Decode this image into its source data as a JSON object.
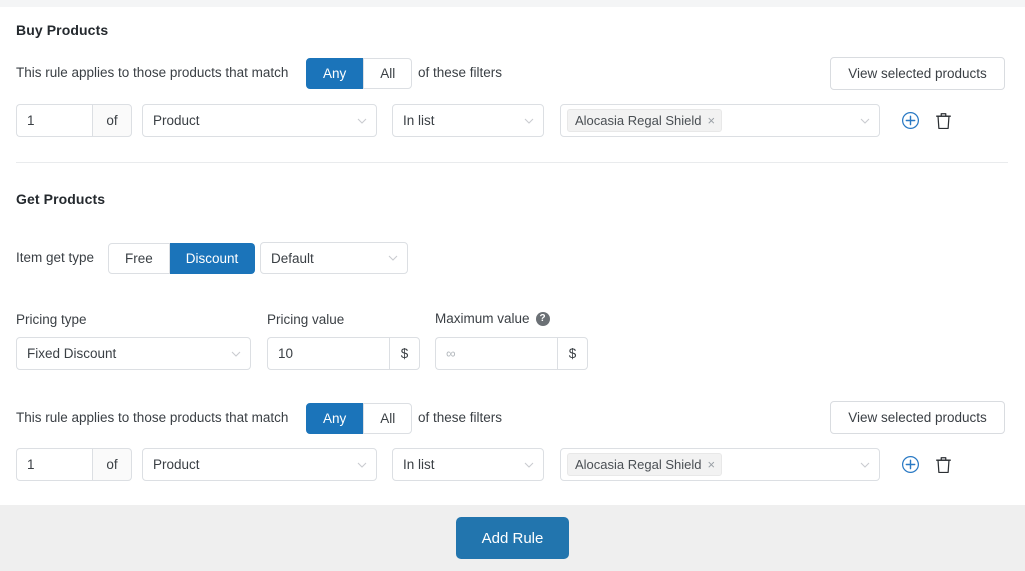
{
  "buy_section": {
    "title": "Buy Products",
    "rule_text_prefix": "This rule applies to those products that match",
    "rule_text_suffix": "of these filters",
    "match_toggle": {
      "options": [
        "Any",
        "All"
      ],
      "selected": "Any"
    },
    "view_selected_button": "View selected products",
    "filter_row": {
      "quantity": "1",
      "quantity_addon": "of",
      "field_select": "Product",
      "operator_select": "In list",
      "tags": [
        "Alocasia Regal Shield"
      ],
      "tag_remove_glyph": "×",
      "add_icon": "plus-circle-icon",
      "delete_icon": "trash-icon"
    }
  },
  "get_section": {
    "title": "Get Products",
    "item_get_type_label": "Item get type",
    "item_get_type_toggle": {
      "options": [
        "Free",
        "Discount"
      ],
      "selected": "Discount"
    },
    "default_select": "Default",
    "pricing_type_label": "Pricing type",
    "pricing_type_select": "Fixed Discount",
    "pricing_value_label": "Pricing value",
    "pricing_value": "10",
    "pricing_value_suffix": "$",
    "maximum_value_label": "Maximum value",
    "maximum_value_help": "?",
    "maximum_value_placeholder": "∞",
    "maximum_value_suffix": "$",
    "rule_text_prefix": "This rule applies to those products that match",
    "rule_text_suffix": "of these filters",
    "match_toggle": {
      "options": [
        "Any",
        "All"
      ],
      "selected": "Any"
    },
    "view_selected_button": "View selected products",
    "filter_row": {
      "quantity": "1",
      "quantity_addon": "of",
      "field_select": "Product",
      "operator_select": "In list",
      "tags": [
        "Alocasia Regal Shield"
      ],
      "tag_remove_glyph": "×",
      "add_icon": "plus-circle-icon",
      "delete_icon": "trash-icon"
    }
  },
  "footer": {
    "add_rule_button": "Add Rule"
  },
  "colors": {
    "accent_blue": "#1b74ba",
    "primary_button": "#2275ae",
    "footer_bg": "#efefef",
    "border": "#dcdfe3"
  }
}
